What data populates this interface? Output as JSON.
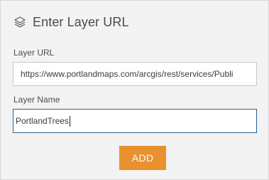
{
  "panel": {
    "title": "Enter Layer URL",
    "title_icon": "layers-icon"
  },
  "form": {
    "url_label": "Layer URL",
    "url_value": "https://www.portlandmaps.com/arcgis/rest/services/Publi",
    "name_label": "Layer Name",
    "name_value": "PortlandTrees"
  },
  "actions": {
    "add_label": "ADD"
  },
  "colors": {
    "panel_background": "#f3f3f3",
    "accent_button": "#e8912e",
    "focus_border": "#2b5f92"
  }
}
